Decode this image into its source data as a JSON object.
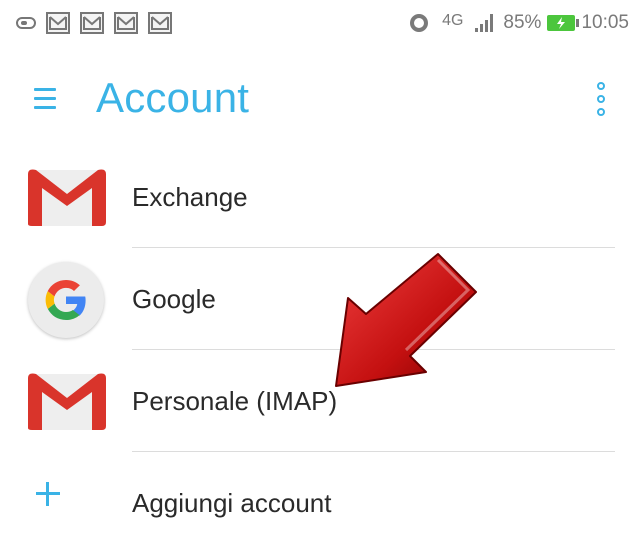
{
  "status_bar": {
    "network": "4G",
    "battery_percent": "85%",
    "time": "10:05",
    "notification_icons": [
      "mail-notification-icon",
      "mail-notification-icon",
      "mail-notification-icon",
      "mail-notification-icon"
    ]
  },
  "appbar": {
    "title": "Account",
    "accent_color": "#3ab3e6"
  },
  "accounts": [
    {
      "label": "Exchange",
      "icon": "gmail-icon"
    },
    {
      "label": "Google",
      "icon": "google-icon"
    },
    {
      "label": "Personale (IMAP)",
      "icon": "gmail-icon"
    },
    {
      "label": "Aggiungi account",
      "icon": "plus-icon"
    }
  ],
  "annotation": {
    "arrow_color": "#d01818",
    "points_to": "Personale (IMAP)"
  }
}
